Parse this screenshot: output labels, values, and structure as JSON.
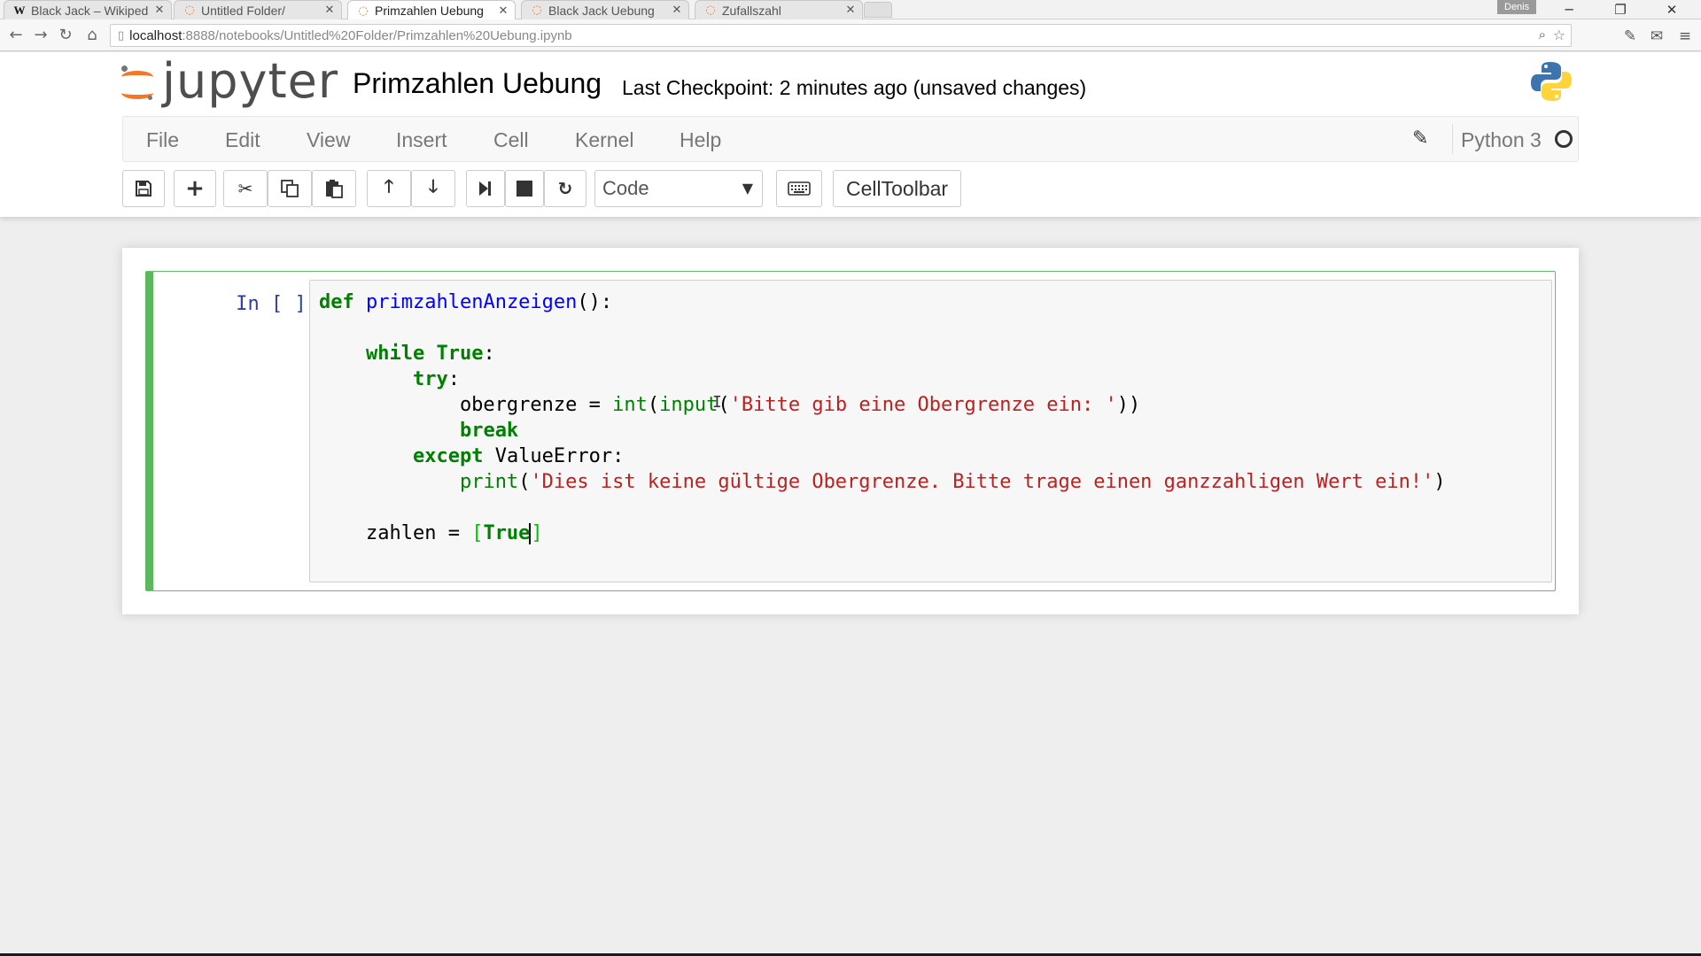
{
  "browser": {
    "tabs": [
      {
        "title": "Black Jack – Wikiped",
        "favicon": "W",
        "active": false
      },
      {
        "title": "Untitled Folder/",
        "favicon": "jupyter",
        "active": false
      },
      {
        "title": "Primzahlen Uebung",
        "favicon": "jupyter",
        "active": true
      },
      {
        "title": "Black Jack Uebung",
        "favicon": "jupyter",
        "active": false
      },
      {
        "title": "Zufallszahl",
        "favicon": "jupyter",
        "active": false
      }
    ],
    "profile_name": "Denis",
    "url_host": "localhost",
    "url_path": ":8888/notebooks/Untitled%20Folder/Primzahlen%20Uebung.ipynb"
  },
  "header": {
    "logo_text": "jupyter",
    "notebook_title": "Primzahlen Uebung",
    "checkpoint": "Last Checkpoint: 2 minutes ago (unsaved changes)"
  },
  "menu": {
    "items": [
      "File",
      "Edit",
      "View",
      "Insert",
      "Cell",
      "Kernel",
      "Help"
    ],
    "kernel_name": "Python 3"
  },
  "toolbar": {
    "cell_type": "Code",
    "celltoolbar_label": "CellToolbar"
  },
  "cell": {
    "prompt": "In [ ]:"
  },
  "colors": {
    "accent_orange": "#f37726",
    "cell_border_green": "#5cb85c",
    "prompt_blue": "#303f9f",
    "keyword_green": "#008000",
    "function_blue": "#0000ff",
    "string_red": "#ba2121"
  }
}
